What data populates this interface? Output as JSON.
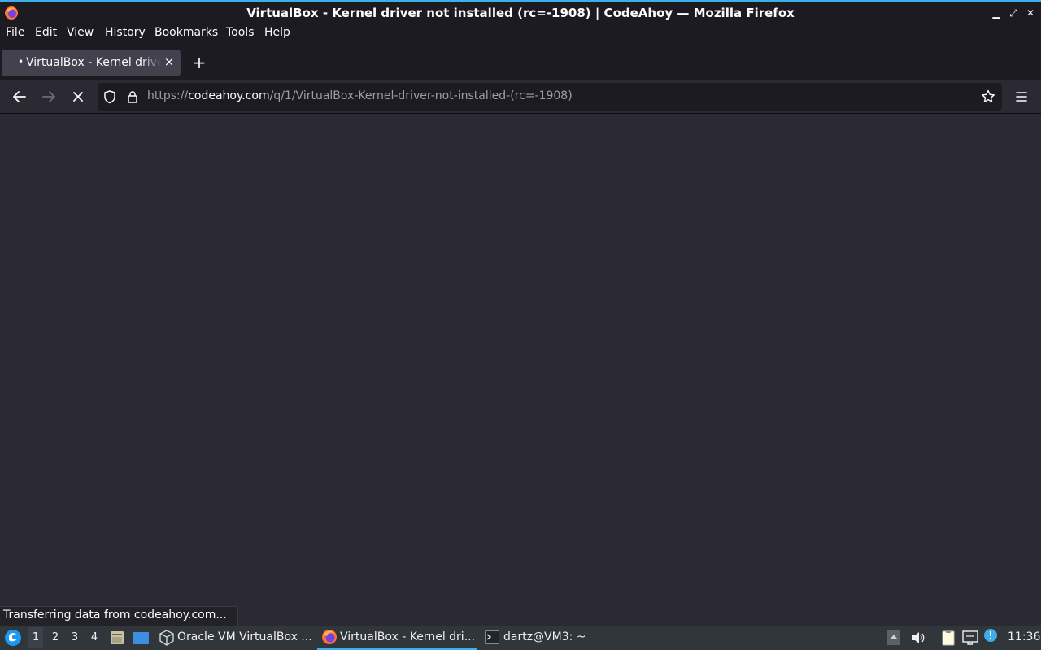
{
  "window": {
    "title": "VirtualBox - Kernel driver not installed (rc=-1908) | CodeAhoy — Mozilla Firefox"
  },
  "menu": {
    "file": "File",
    "edit": "Edit",
    "view": "View",
    "history": "History",
    "bookmarks": "Bookmarks",
    "tools": "Tools",
    "help": "Help"
  },
  "tab": {
    "label": "VirtualBox - Kernel driver not installed (rc=-1908) | CodeAhoy",
    "bullet": "•",
    "close": "×"
  },
  "newtab": "+",
  "url": {
    "scheme": "https://",
    "host": "codeahoy.com",
    "path": "/q/1/VirtualBox-Kernel-driver-not-installed-(rc=-1908)"
  },
  "status": "Transferring data from codeahoy.com...",
  "taskbar": {
    "desktops": [
      "1",
      "2",
      "3",
      "4"
    ],
    "tasks": [
      {
        "label": "Oracle VM VirtualBox ..."
      },
      {
        "label": "VirtualBox - Kernel dri..."
      },
      {
        "label": "dartz@VM3: ~"
      }
    ],
    "clock": "11:36"
  },
  "colors": {
    "accent": "#3daee9",
    "firefox_dark": "#1c1b22",
    "toolbar": "#2b2a33"
  }
}
